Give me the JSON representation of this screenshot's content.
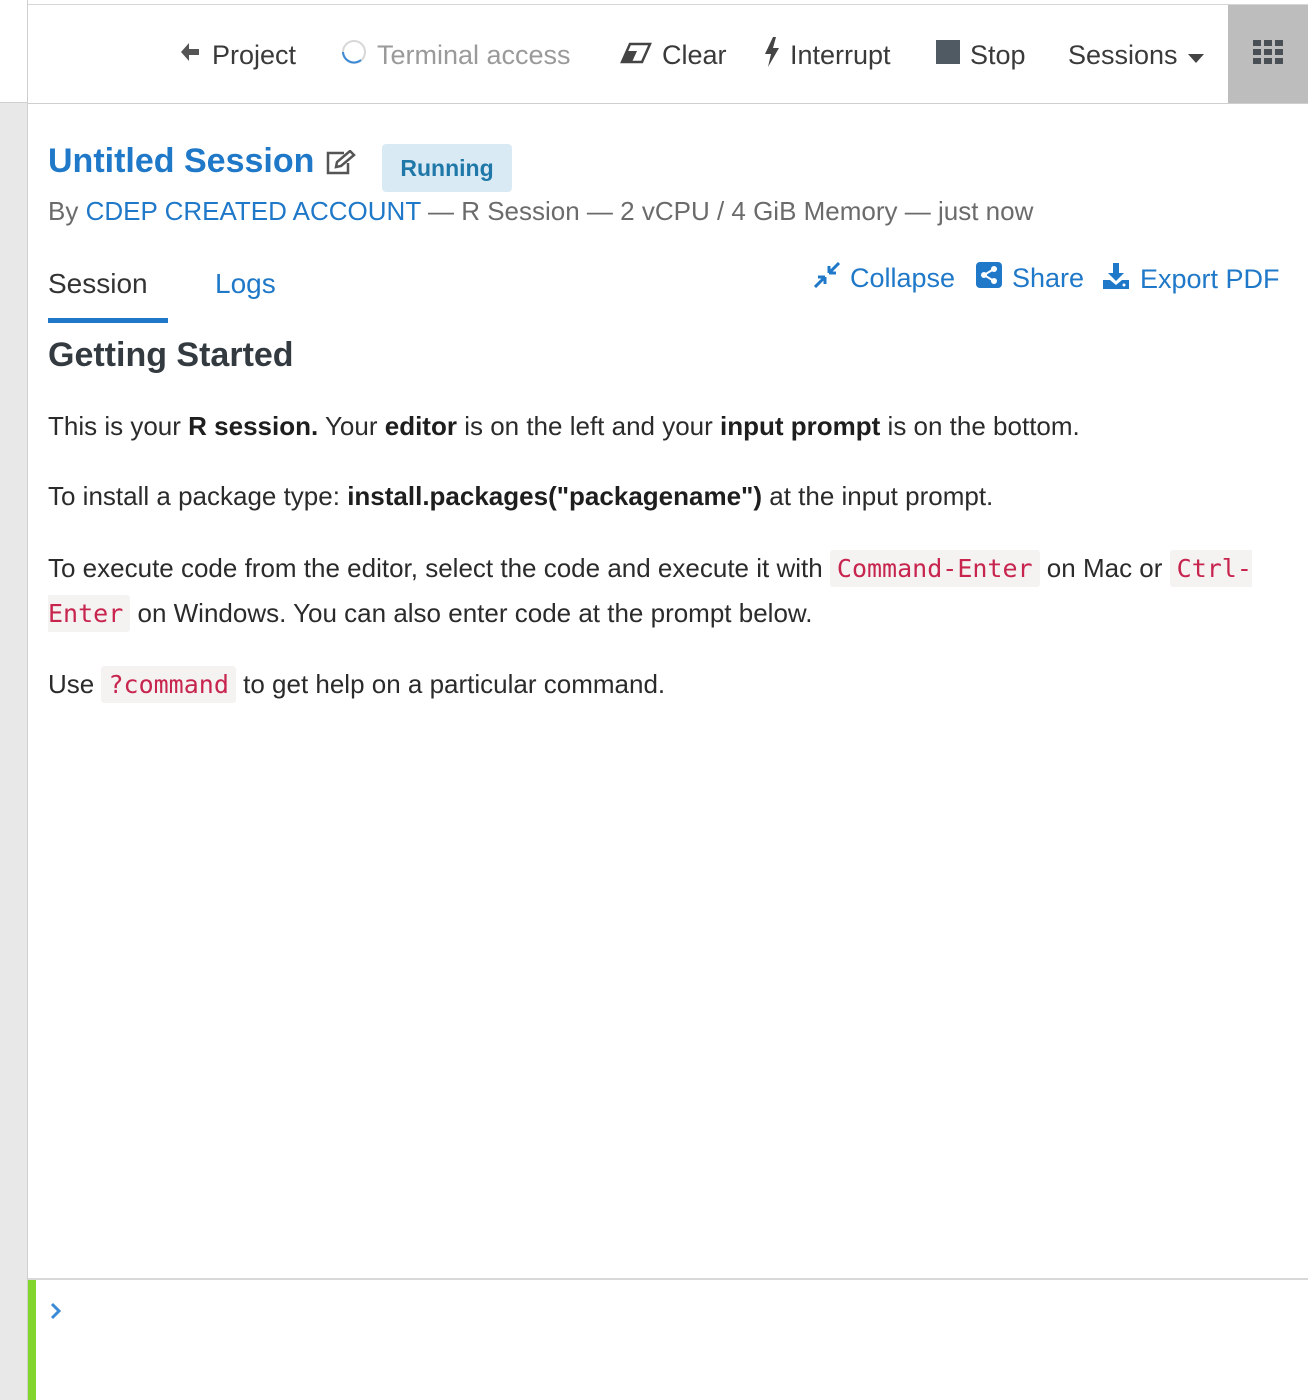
{
  "toolbar": {
    "project_label": "Project",
    "terminal_label": "Terminal access",
    "clear_label": "Clear",
    "interrupt_label": "Interrupt",
    "stop_label": "Stop",
    "sessions_label": "Sessions"
  },
  "session": {
    "title": "Untitled Session",
    "status": "Running",
    "meta_by": "By",
    "meta_account": "CDEP CREATED ACCOUNT",
    "meta_rest": "— R Session — 2 vCPU / 4 GiB Memory — just now"
  },
  "tabs": {
    "session_label": "Session",
    "logs_label": "Logs"
  },
  "actions": {
    "collapse_label": "Collapse",
    "share_label": "Share",
    "export_label": "Export PDF"
  },
  "content": {
    "heading": "Getting Started",
    "p1": {
      "t1": "This is your ",
      "b1": "R session.",
      "t2": " Your ",
      "b2": "editor",
      "t3": " is on the left and your ",
      "b3": "input prompt",
      "t4": " is on the bottom."
    },
    "p2": {
      "t1": "To install a package type: ",
      "b1": "install.packages(\"packagename\")",
      "t2": " at the input prompt."
    },
    "p3": {
      "t1": "To execute code from the editor, select the code and execute it with ",
      "code1": "Command-Enter",
      "t2": " on Mac or ",
      "code2": "Ctrl-Enter",
      "t3": " on Windows. You can also enter code at the prompt below."
    },
    "p4": {
      "t1": "Use ",
      "code1": "?command",
      "t2": " to get help on a particular command."
    }
  },
  "prompt": {
    "value": ""
  },
  "icons": {
    "back": "arrow-left-icon",
    "terminal": "spinner-icon",
    "clear": "eraser-icon",
    "interrupt": "bolt-icon",
    "stop": "stop-square-icon",
    "sessions": "caret-down-icon",
    "apps": "grid-icon",
    "edit": "pencil-square-icon",
    "collapse": "compress-icon",
    "share": "share-square-icon",
    "export": "download-icon",
    "prompt": "chevron-right-icon"
  },
  "colors": {
    "link": "#1f78c8",
    "badge_bg": "#daeaf5",
    "code": "#c7254e",
    "prompt_bar": "#82d62b"
  }
}
